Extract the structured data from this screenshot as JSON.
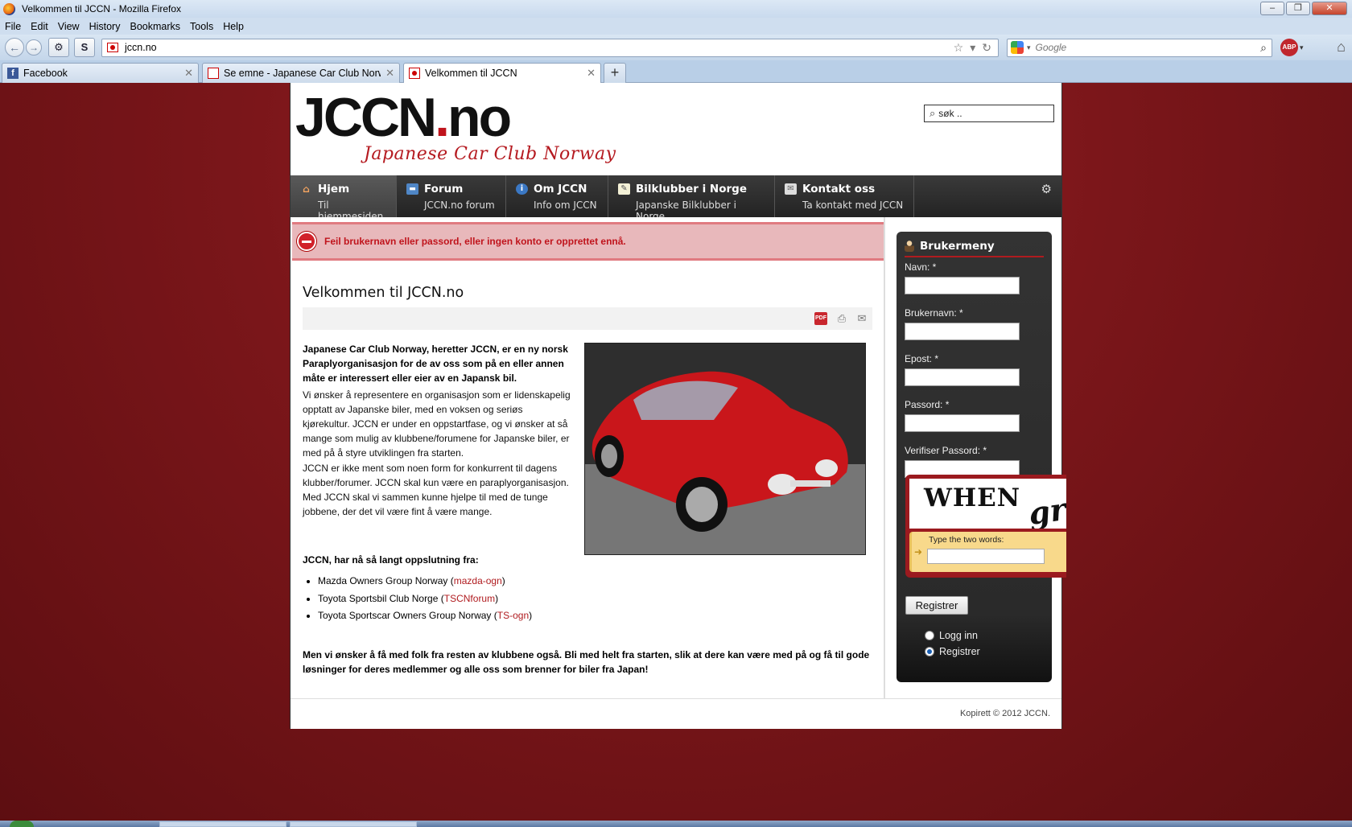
{
  "window": {
    "title": "Velkommen til JCCN - Mozilla Firefox"
  },
  "menubar": [
    "File",
    "Edit",
    "View",
    "History",
    "Bookmarks",
    "Tools",
    "Help"
  ],
  "urlbar": {
    "url": "jccn.no"
  },
  "searchbar": {
    "placeholder": "Google"
  },
  "tabs": [
    {
      "label": "Facebook"
    },
    {
      "label": "Se emne - Japanese Car Club Norway"
    },
    {
      "label": "Velkommen til JCCN"
    }
  ],
  "site": {
    "logo_main": "JCCN",
    "logo_dot": ".",
    "logo_tld": "no",
    "logo_sub": "Japanese Car Club Norway",
    "search_value": "søk ..",
    "nav": [
      {
        "title": "Hjem",
        "sub": "Til hjemmesiden"
      },
      {
        "title": "Forum",
        "sub": "JCCN.no forum"
      },
      {
        "title": "Om JCCN",
        "sub": "Info om JCCN"
      },
      {
        "title": "Bilklubber i Norge",
        "sub": "Japanske Bilklubber i Norge"
      },
      {
        "title": "Kontakt oss",
        "sub": "Ta kontakt med JCCN"
      }
    ],
    "error": "Feil brukernavn eller passord, eller ingen konto er opprettet ennå.",
    "article": {
      "title": "Velkommen til JCCN.no",
      "pdf_label": "PDF",
      "intro": "Japanese Car Club Norway, heretter JCCN, er en ny norsk Paraplyorganisasjon for de av oss som på en eller annen måte er interessert eller eier av en Japansk bil.",
      "p1": "Vi ønsker å representere en organisasjon som er lidenskapelig opptatt av Japanske biler, med en voksen og seriøs kjørekultur. JCCN er under en oppstartfase, og vi ønsker at så mange som mulig av klubbene/forumene for Japanske biler, er med på å styre utviklingen fra starten.",
      "p2": "JCCN er ikke ment som noen form for konkurrent til dagens klubber/forumer. JCCN skal kun være en paraplyorganisasjon. Med JCCN skal vi sammen kunne hjelpe til med de tunge jobbene, der det vil være fint å være mange.",
      "members_heading": "JCCN, har nå så langt oppslutning fra:",
      "members": [
        {
          "name": "Mazda Owners Group Norway",
          "link": "mazda-ogn"
        },
        {
          "name": "Toyota Sportsbil Club Norge",
          "link": "TSCNforum"
        },
        {
          "name": "Toyota Sportscar Owners Group Norway",
          "link": "TS-ogn"
        }
      ],
      "outro": "Men vi ønsker å få med folk fra resten av klubbene også. Bli med helt fra starten, slik at dere kan være med på og få til gode løsninger for deres medlemmer og alle oss som brenner for biler fra Japan!"
    },
    "usermenu": {
      "title": "Brukermeny",
      "fields": [
        {
          "label": "Navn: *"
        },
        {
          "label": "Brukernavn: *"
        },
        {
          "label": "Epost: *"
        },
        {
          "label": "Passord: *"
        },
        {
          "label": "Verifiser Passord: *"
        }
      ],
      "captcha_word1": "WHEN",
      "captcha_word2": "gr",
      "captcha_prompt": "Type the two words:",
      "register_button": "Registrer",
      "radio_login": "Logg inn",
      "radio_register": "Registrer"
    },
    "footer": "Kopirett © 2012 JCCN."
  },
  "colors": {
    "accent": "#b01b1f",
    "error_bg": "#e8b8bb",
    "nav_bg": "#2b2b2b"
  }
}
